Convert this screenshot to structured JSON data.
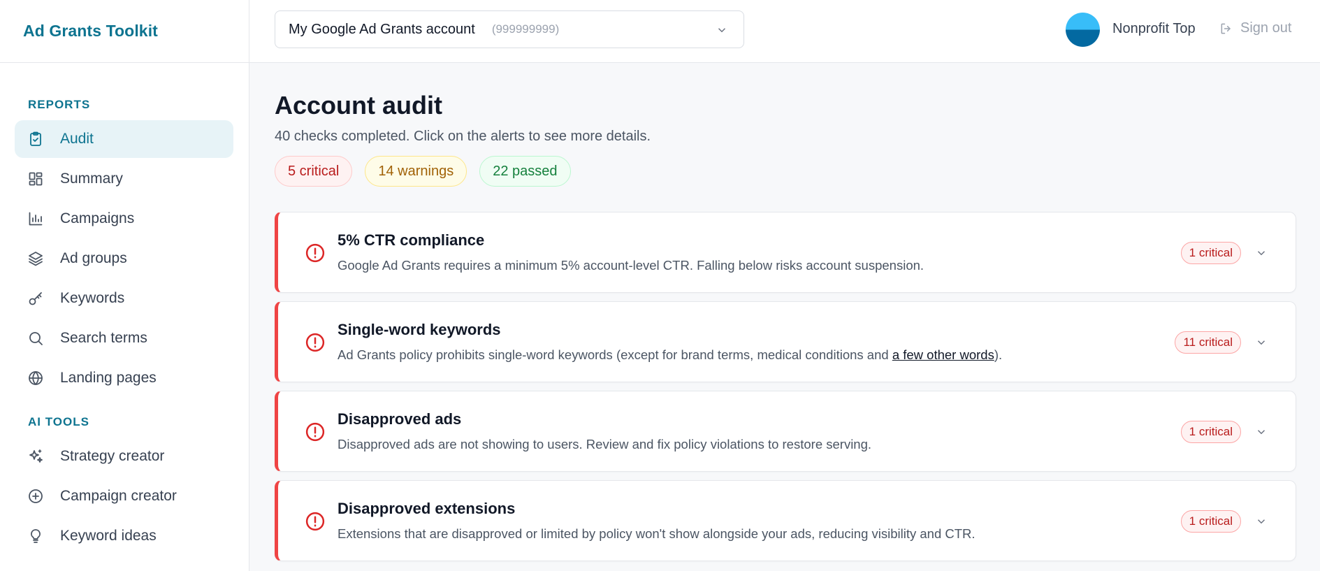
{
  "brand": "Ad Grants Toolkit",
  "sidebar": {
    "reports_label": "REPORTS",
    "reports": [
      {
        "label": "Audit",
        "icon": "clipboard-check-icon",
        "active": true
      },
      {
        "label": "Summary",
        "icon": "dashboard-icon"
      },
      {
        "label": "Campaigns",
        "icon": "bar-chart-icon"
      },
      {
        "label": "Ad groups",
        "icon": "layers-icon"
      },
      {
        "label": "Keywords",
        "icon": "key-icon"
      },
      {
        "label": "Search terms",
        "icon": "search-icon"
      },
      {
        "label": "Landing pages",
        "icon": "globe-icon"
      }
    ],
    "ai_label": "AI TOOLS",
    "ai_tools": [
      {
        "label": "Strategy creator",
        "icon": "sparkles-icon"
      },
      {
        "label": "Campaign creator",
        "icon": "plus-circle-icon"
      },
      {
        "label": "Keyword ideas",
        "icon": "lightbulb-icon"
      }
    ]
  },
  "header": {
    "account_name": "My Google Ad Grants account",
    "account_id": "(999999999)",
    "user_name": "Nonprofit Top",
    "signout_label": "Sign out"
  },
  "main": {
    "title": "Account audit",
    "subtitle": "40 checks completed. Click on the alerts to see more details.",
    "pills": {
      "critical": "5 critical",
      "warnings": "14 warnings",
      "passed": "22 passed"
    },
    "cards": [
      {
        "title": "5% CTR compliance",
        "desc": "Google Ad Grants requires a minimum 5% account-level CTR. Falling below risks account suspension.",
        "badge": "1 critical"
      },
      {
        "title": "Single-word keywords",
        "desc_before": "Ad Grants policy prohibits single-word keywords (except for brand terms, medical conditions and ",
        "desc_link": "a few other words",
        "desc_after": ").",
        "badge": "11 critical"
      },
      {
        "title": "Disapproved ads",
        "desc": "Disapproved ads are not showing to users. Review and fix policy violations to restore serving.",
        "badge": "1 critical"
      },
      {
        "title": "Disapproved extensions",
        "desc": "Extensions that are disapproved or limited by policy won't show alongside your ads, reducing visibility and CTR.",
        "badge": "1 critical"
      }
    ]
  },
  "colors": {
    "accent": "#0e7490",
    "critical": "#ef4444",
    "warning": "#a16207",
    "passed": "#15803d"
  }
}
